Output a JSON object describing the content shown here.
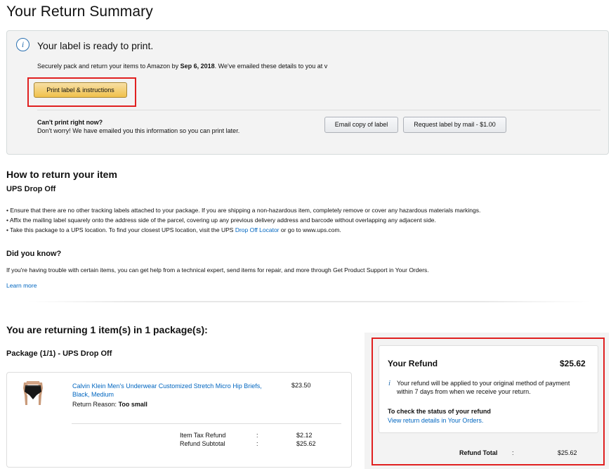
{
  "page": {
    "title": "Your Return Summary"
  },
  "alert": {
    "heading": "Your label is ready to print.",
    "body_prefix": "Securely pack and return your items to Amazon by ",
    "deadline": "Sep 6, 2018",
    "body_suffix": ". We've emailed these details to you at v",
    "print_button": "Print label & instructions",
    "cant_print_heading": "Can't print right now?",
    "cant_print_body": "Don't worry! We have emailed you this information so you can print later.",
    "email_button": "Email copy of label",
    "request_button": "Request label by mail - $1.00"
  },
  "how_to": {
    "heading": "How to return your item",
    "method": "UPS Drop Off",
    "bullets": [
      "• Ensure that there are no other tracking labels attached to your package. If you are shipping a non-hazardous item, completely remove or cover any hazardous materials markings.",
      "• Affix the mailing label squarely onto the address side of the parcel, covering up any previous delivery address and barcode without overlapping any adjacent side."
    ],
    "bullet3_prefix": "• Take this package to a UPS location. To find your closest UPS location, visit the UPS ",
    "bullet3_link": "Drop Off Locator",
    "bullet3_suffix": " or go to www.ups.com."
  },
  "did_you_know": {
    "heading": "Did you know?",
    "body": "If you're having trouble with certain items, you can get help from a technical expert, send items for repair, and more through Get Product Support in Your Orders.",
    "learn_more": "Learn more"
  },
  "returning": {
    "heading": "You are returning 1 item(s) in 1 package(s):",
    "package_heading": "Package (1/1) - UPS Drop Off",
    "item": {
      "title": "Calvin Klein Men's Underwear Customized Stretch Micro Hip Briefs, Black, Medium",
      "price": "$23.50",
      "reason_label": "Return Reason:",
      "reason_value": "Too small"
    },
    "summary": {
      "tax_label": "Item Tax Refund",
      "tax_value": "$2.12",
      "subtotal_label": "Refund Subtotal",
      "subtotal_value": "$25.62",
      "colon": ":"
    }
  },
  "refund": {
    "heading": "Your Refund",
    "amount": "$25.62",
    "note": "Your refund will be applied to your original method of payment within 7 days from when we receive your return.",
    "status_heading": "To check the status of your refund",
    "status_link": "View return details in Your Orders.",
    "total_label": "Refund Total",
    "total_colon": ":",
    "total_value": "$25.62"
  },
  "colors": {
    "link": "#0066c0",
    "highlight": "#e02020",
    "primary_button": "#f0c14b"
  },
  "icons": {
    "info": "info-icon",
    "product": "product-image"
  }
}
